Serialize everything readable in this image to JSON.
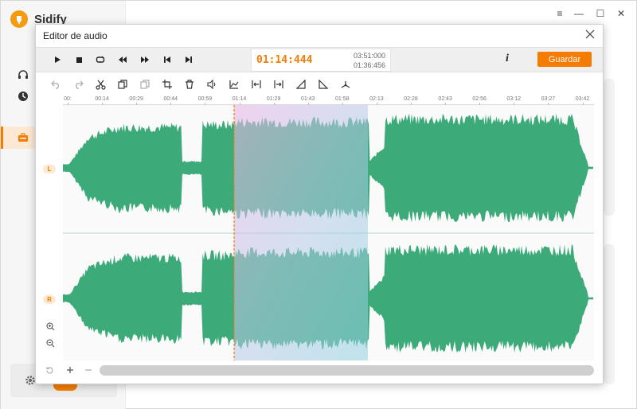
{
  "app": {
    "name": "Sidify",
    "window_controls": [
      "≡",
      "—",
      "☐",
      "✕"
    ]
  },
  "dialog": {
    "title": "Editor de audio",
    "current_time": "01:14:444",
    "time_top": "03:51:000",
    "time_bottom": "01:36:456",
    "info_label": "i",
    "save_label": "Guardar"
  },
  "transport": [
    {
      "name": "play-icon"
    },
    {
      "name": "stop-icon"
    },
    {
      "name": "loop-icon"
    },
    {
      "name": "rewind-icon"
    },
    {
      "name": "fast-forward-icon"
    },
    {
      "name": "skip-start-icon"
    },
    {
      "name": "skip-end-icon"
    }
  ],
  "tools": [
    "undo-icon",
    "redo-icon",
    "cut-icon",
    "copy-icon",
    "paste-icon",
    "crop-icon",
    "delete-icon",
    "volume-icon",
    "amplify-icon",
    "trim-in-icon",
    "trim-out-icon",
    "fade-in-icon",
    "fade-out-icon",
    "noise-icon"
  ],
  "ruler": {
    "ticks": [
      "00:",
      "00:14",
      "00:29",
      "00:44",
      "00:59",
      "01:14",
      "01:29",
      "01:43",
      "01:58",
      "02:13",
      "02:28",
      "02:43",
      "02:56",
      "03:12",
      "03:27",
      "03:42"
    ]
  },
  "channels": {
    "left": "L",
    "right": "R"
  },
  "colors": {
    "accent": "#f57c00",
    "wave": "#3daa7a",
    "selection": "#b9cfe8"
  }
}
